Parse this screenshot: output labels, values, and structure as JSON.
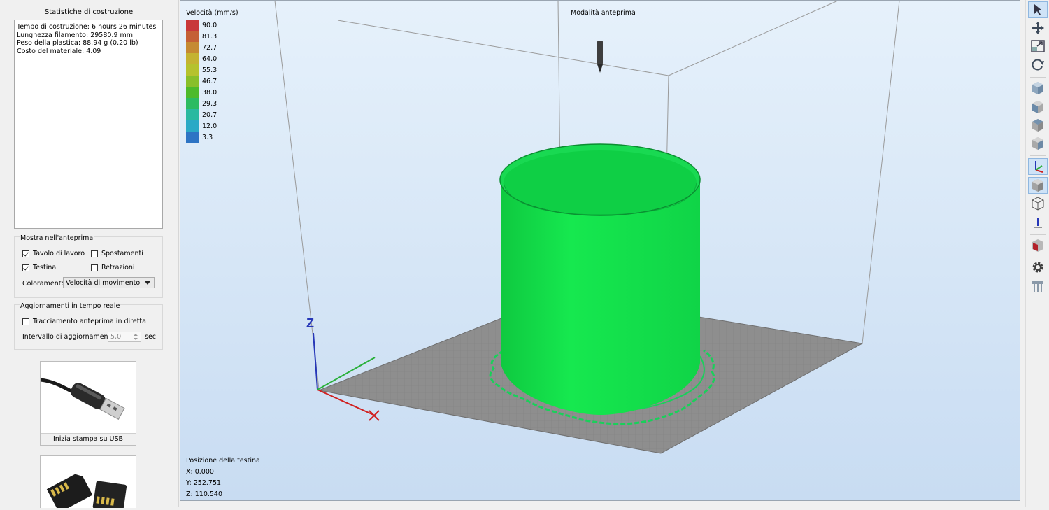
{
  "stats": {
    "title": "Statistiche di costruzione",
    "lines": [
      "Tempo di costruzione: 6 hours 26 minutes",
      "Lunghezza filamento: 29580.9 mm",
      "Peso della plastica: 88.94 g (0.20 lb)",
      "Costo del materiale: 4.09"
    ]
  },
  "preview_group": {
    "title": "Mostra nell'anteprima",
    "checkboxes": [
      {
        "label": "Tavolo di lavoro",
        "checked": true
      },
      {
        "label": "Spostamenti",
        "checked": false
      },
      {
        "label": "Testina",
        "checked": true
      },
      {
        "label": "Retrazioni",
        "checked": false
      }
    ],
    "coloring_label": "Coloramento",
    "coloring_value": "Velocità di movimento"
  },
  "realtime_group": {
    "title": "Aggiornamenti in tempo reale",
    "live_trace_label": "Tracciamento anteprima in diretta",
    "live_trace_checked": false,
    "interval_label": "Intervallo di aggiornamento",
    "interval_value": "5,0",
    "interval_unit": "sec"
  },
  "cards": {
    "usb_label": "Inizia stampa su USB"
  },
  "viewport": {
    "mode_label": "Modalità anteprima",
    "legend_title": "Velocità (mm/s)",
    "legend": [
      {
        "value": "90.0",
        "color": "#c8383a"
      },
      {
        "value": "81.3",
        "color": "#c46036"
      },
      {
        "value": "72.7",
        "color": "#c58a33"
      },
      {
        "value": "64.0",
        "color": "#c4b332"
      },
      {
        "value": "55.3",
        "color": "#b5c22e"
      },
      {
        "value": "46.7",
        "color": "#88bf2b"
      },
      {
        "value": "38.0",
        "color": "#4cba2c"
      },
      {
        "value": "29.3",
        "color": "#2bbb62"
      },
      {
        "value": "20.7",
        "color": "#29b9a0"
      },
      {
        "value": "12.0",
        "color": "#2aa9c6"
      },
      {
        "value": "3.3",
        "color": "#2d74c4"
      }
    ],
    "axis_z": "Z",
    "position_title": "Posizione della testina",
    "pos_x": "X: 0.000",
    "pos_y": "Y: 252.751",
    "pos_z": "Z: 110.540"
  },
  "colors": {
    "model_green": "#12e04a",
    "bed_gray": "#8e8e8e",
    "viewport_top": "#e6f1fb",
    "viewport_bottom": "#c8dcf2",
    "toolbar_active": "#cfe3f7"
  },
  "toolbar": [
    "select-arrow-icon",
    "move-icon",
    "scale-icon",
    "rotate-icon",
    "view-cube-1-icon",
    "view-cube-2-icon",
    "view-cube-3-icon",
    "view-cube-4-icon",
    "axes-icon",
    "solid-cube-icon",
    "wireframe-cube-icon",
    "bed-axis-icon",
    "cut-cube-icon",
    "settings-gear-icon",
    "supports-icon"
  ]
}
